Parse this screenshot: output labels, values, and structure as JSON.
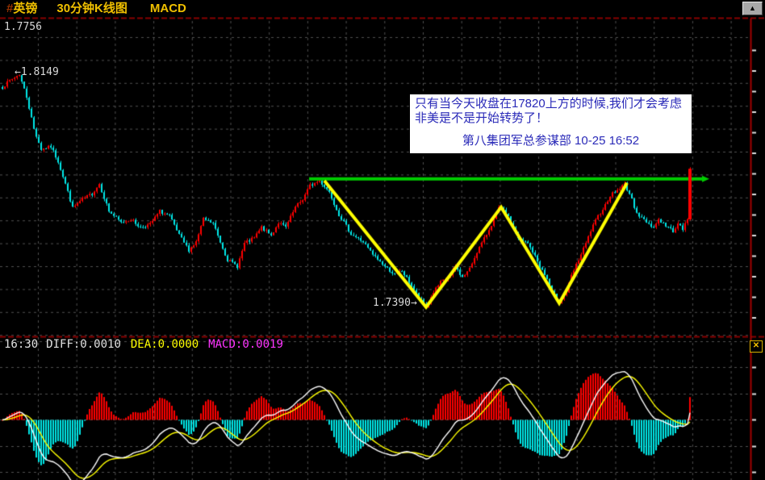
{
  "window": {
    "title_hash": "#",
    "symbol": "英镑",
    "period_label": "30分钟K线图",
    "indicator_label": "MACD"
  },
  "price_labels": {
    "current": "1.7756",
    "high_arrow": "←",
    "high": "1.8149",
    "low": "1.7390",
    "low_arrow": "→"
  },
  "annotation": {
    "body": "只有当今天收盘在17820上方的时候,我们才会考虑非美是不是开始转势了！",
    "signature": "第八集团军总参谋部 10-25 16:52"
  },
  "macd_header": {
    "time": "16:30",
    "diff": "DIFF:0.0010",
    "dea": "DEA:0.0000",
    "macd": "MACD:0.0019"
  },
  "icons": {
    "scroll_up": "▲",
    "close": "✕"
  },
  "chart_data": {
    "type": "candlestick",
    "symbol": "英镑",
    "timeframe": "30分钟",
    "indicator": "MACD",
    "visible_high": 1.8149,
    "visible_low": 1.739,
    "current_price": 1.7756,
    "last_time": "16:30",
    "calibration": {
      "high_price": 1.8149,
      "low_price": 1.739
    },
    "candle_count": 285,
    "candle_up_color": "#ff0000",
    "candle_down_color": "#00e8e8",
    "close_anchors": [
      [
        0,
        1.8102
      ],
      [
        3,
        1.8123
      ],
      [
        7,
        1.8144
      ],
      [
        10,
        1.8071
      ],
      [
        13,
        1.7968
      ],
      [
        16,
        1.7903
      ],
      [
        20,
        1.7911
      ],
      [
        23,
        1.7864
      ],
      [
        26,
        1.7792
      ],
      [
        29,
        1.7714
      ],
      [
        33,
        1.7742
      ],
      [
        37,
        1.776
      ],
      [
        40,
        1.7792
      ],
      [
        44,
        1.7704
      ],
      [
        49,
        1.7667
      ],
      [
        53,
        1.7678
      ],
      [
        57,
        1.7652
      ],
      [
        61,
        1.7662
      ],
      [
        65,
        1.7704
      ],
      [
        69,
        1.7688
      ],
      [
        73,
        1.7626
      ],
      [
        77,
        1.7579
      ],
      [
        80,
        1.7605
      ],
      [
        83,
        1.7678
      ],
      [
        87,
        1.7665
      ],
      [
        90,
        1.7605
      ],
      [
        93,
        1.7548
      ],
      [
        97,
        1.7527
      ],
      [
        100,
        1.76
      ],
      [
        104,
        1.7618
      ],
      [
        107,
        1.7652
      ],
      [
        111,
        1.7626
      ],
      [
        114,
        1.7667
      ],
      [
        117,
        1.7652
      ],
      [
        121,
        1.7716
      ],
      [
        124,
        1.7742
      ],
      [
        127,
        1.7786
      ],
      [
        131,
        1.7802
      ],
      [
        135,
        1.7766
      ],
      [
        139,
        1.7693
      ],
      [
        144,
        1.7631
      ],
      [
        149,
        1.7605
      ],
      [
        153,
        1.7564
      ],
      [
        158,
        1.7527
      ],
      [
        162,
        1.7501
      ],
      [
        165,
        1.7512
      ],
      [
        169,
        1.7465
      ],
      [
        172,
        1.7424
      ],
      [
        175,
        1.7396
      ],
      [
        178,
        1.7444
      ],
      [
        181,
        1.7475
      ],
      [
        185,
        1.7496
      ],
      [
        187,
        1.7527
      ],
      [
        190,
        1.7491
      ],
      [
        193,
        1.7519
      ],
      [
        196,
        1.7574
      ],
      [
        199,
        1.7615
      ],
      [
        203,
        1.7677
      ],
      [
        205,
        1.7714
      ],
      [
        208,
        1.7698
      ],
      [
        211,
        1.7652
      ],
      [
        213,
        1.7615
      ],
      [
        217,
        1.76
      ],
      [
        219,
        1.7574
      ],
      [
        222,
        1.7527
      ],
      [
        225,
        1.7486
      ],
      [
        227,
        1.7444
      ],
      [
        230,
        1.7413
      ],
      [
        233,
        1.7444
      ],
      [
        235,
        1.7496
      ],
      [
        238,
        1.7548
      ],
      [
        241,
        1.76
      ],
      [
        243,
        1.7641
      ],
      [
        246,
        1.7688
      ],
      [
        249,
        1.7724
      ],
      [
        251,
        1.7755
      ],
      [
        254,
        1.7771
      ],
      [
        257,
        1.7791
      ],
      [
        259,
        1.776
      ],
      [
        261,
        1.7719
      ],
      [
        263,
        1.7688
      ],
      [
        266,
        1.767
      ],
      [
        269,
        1.7652
      ],
      [
        271,
        1.7678
      ],
      [
        274,
        1.7657
      ],
      [
        277,
        1.7641
      ],
      [
        279,
        1.7662
      ],
      [
        281,
        1.7646
      ],
      [
        283,
        1.7678
      ],
      [
        284,
        1.784
      ]
    ],
    "overlays": {
      "resistance_line": {
        "color": "#00cc00",
        "price": 1.7808,
        "from_index": 127,
        "to_index": 290,
        "note_level": "17820"
      },
      "trend_zigzag": {
        "color": "#ffff00",
        "points": [
          [
            133,
            1.7802
          ],
          [
            175,
            1.7396
          ],
          [
            206,
            1.7717
          ],
          [
            230,
            1.7409
          ],
          [
            258,
            1.7795
          ]
        ]
      }
    },
    "macd": {
      "diff": 0.001,
      "dea": 0.0,
      "macd": 0.0019,
      "hist_up_color": "#ff0000",
      "hist_down_color": "#00e8e8",
      "diff_line_color": "#ffffff",
      "dea_line_color": "#ffff00"
    }
  }
}
